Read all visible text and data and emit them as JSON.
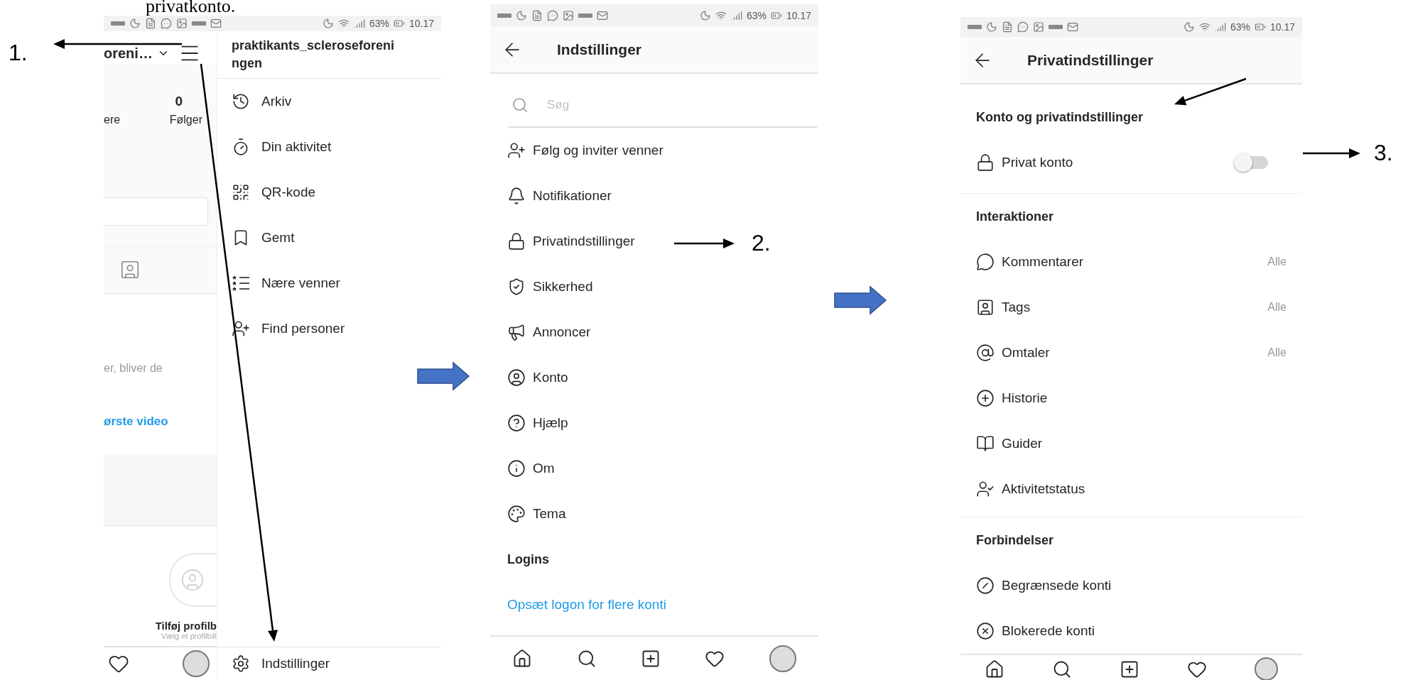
{
  "instruction_title": "privatkonto.",
  "annotations": [
    {
      "label": "1."
    },
    {
      "label": "2."
    },
    {
      "label": "3."
    }
  ],
  "profile_screen": {
    "status_bar": {
      "battery": "63%",
      "time": "10.17"
    },
    "profile": {
      "username": "oreni…",
      "count": "0",
      "stat_labels": [
        "ere",
        "Følger"
      ],
      "hint": "er, bliver de",
      "link": "ørste video",
      "add_photo_title": "Tilføj profilb",
      "add_photo_hint": "Vælg et profilbill"
    },
    "menu": {
      "username": "praktikants_scleroseforeningen",
      "items": [
        {
          "label": "Arkiv"
        },
        {
          "label": "Din aktivitet"
        },
        {
          "label": "QR-kode"
        },
        {
          "label": "Gemt"
        },
        {
          "label": "Nære venner"
        },
        {
          "label": "Find personer"
        }
      ],
      "footer": "Indstillinger"
    }
  },
  "settings_screen": {
    "status_bar": {
      "battery": "63%",
      "time": "10.17"
    },
    "title": "Indstillinger",
    "search": {
      "placeholder": "Søg"
    },
    "items": [
      {
        "label": "Følg og inviter venner"
      },
      {
        "label": "Notifikationer"
      },
      {
        "label": "Privatindstillinger"
      },
      {
        "label": "Sikkerhed"
      },
      {
        "label": "Annoncer"
      },
      {
        "label": "Konto"
      },
      {
        "label": "Hjælp"
      },
      {
        "label": "Om"
      },
      {
        "label": "Tema"
      }
    ],
    "section": "Logins",
    "link": "Opsæt logon for flere konti"
  },
  "privacy_screen": {
    "status_bar": {
      "battery": "63%",
      "time": "10.17"
    },
    "title": "Privatindstillinger",
    "sections": [
      {
        "heading": "Konto og privatindstillinger",
        "items": [
          {
            "label": "Privat konto",
            "kind": "toggle",
            "on": false
          }
        ]
      },
      {
        "heading": "Interaktioner",
        "items": [
          {
            "label": "Kommentarer",
            "kind": "value",
            "value": "Alle"
          },
          {
            "label": "Tags",
            "kind": "value",
            "value": "Alle"
          },
          {
            "label": "Omtaler",
            "kind": "value",
            "value": "Alle"
          },
          {
            "label": "Historie",
            "kind": "plain"
          },
          {
            "label": "Guider",
            "kind": "plain"
          },
          {
            "label": "Aktivitetstatus",
            "kind": "plain"
          }
        ]
      },
      {
        "heading": "Forbindelser",
        "items": [
          {
            "label": "Begrænsede konti",
            "kind": "plain"
          },
          {
            "label": "Blokerede konti",
            "kind": "plain"
          }
        ]
      }
    ]
  }
}
